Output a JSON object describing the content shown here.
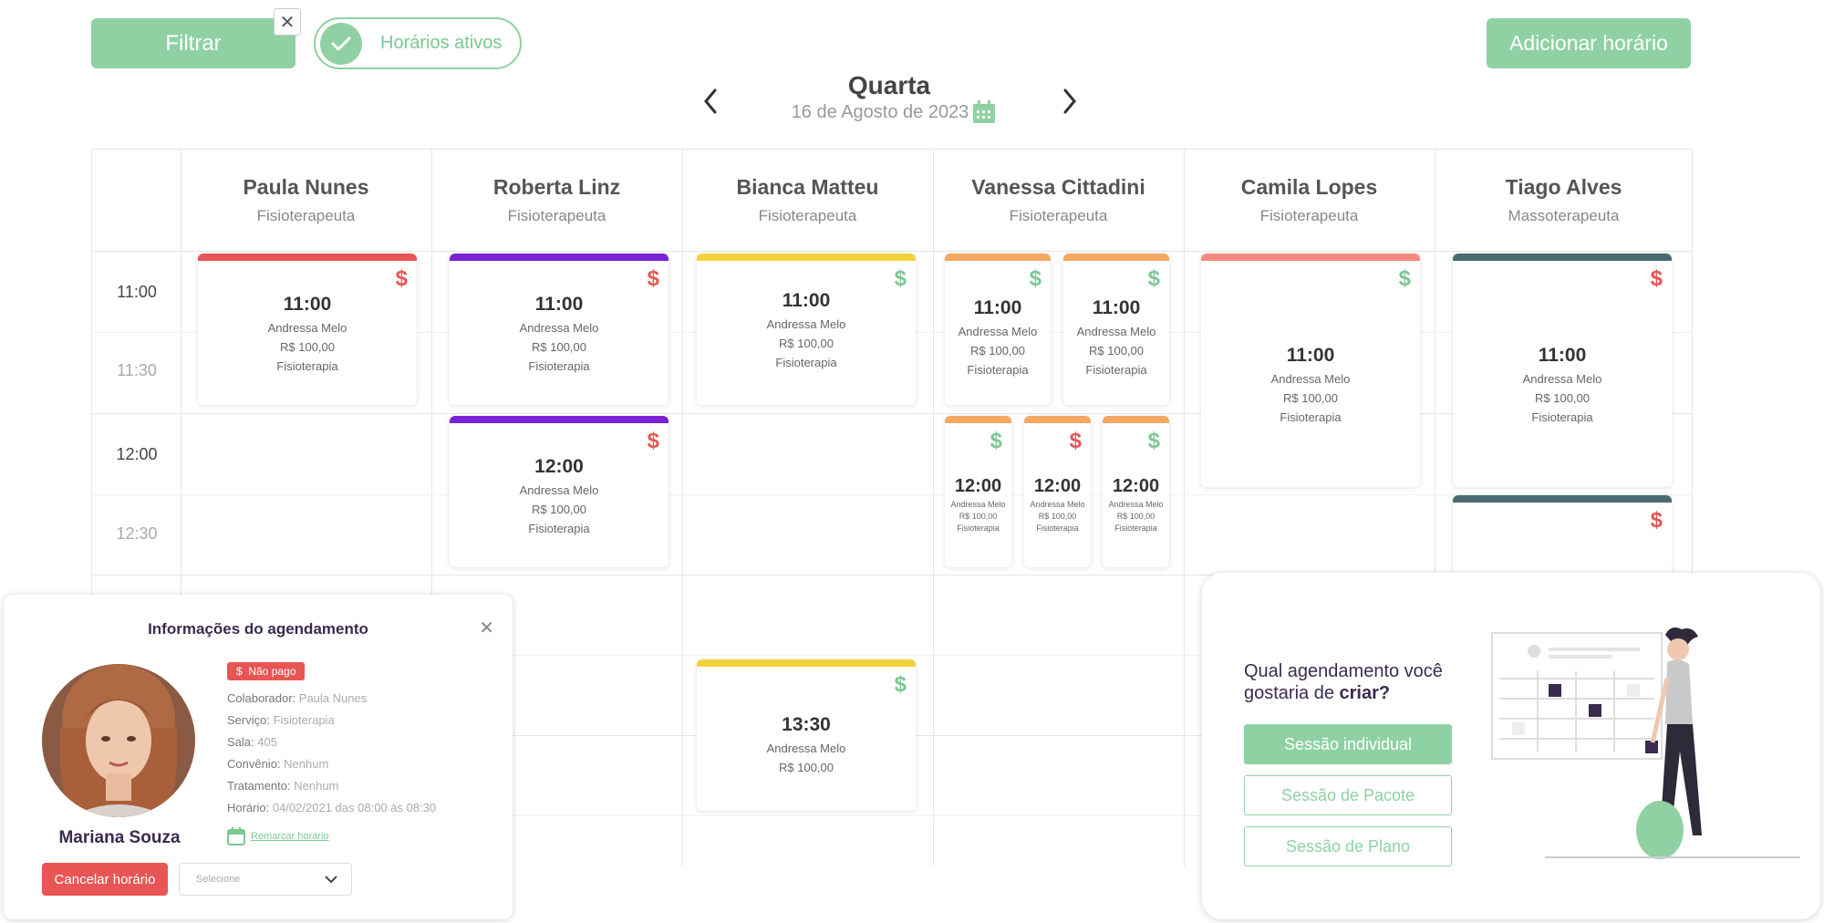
{
  "toolbar": {
    "filter_label": "Filtrar",
    "active_toggle_label": "Horários ativos",
    "add_label": "Adicionar horário"
  },
  "date_nav": {
    "weekday": "Quarta",
    "date": "16 de Agosto de 2023"
  },
  "time_labels": [
    "11:00",
    "11:30",
    "12:00",
    "12:30"
  ],
  "columns": [
    {
      "name": "Paula Nunes",
      "role": "Fisioterapeuta"
    },
    {
      "name": "Roberta Linz",
      "role": "Fisioterapeuta"
    },
    {
      "name": "Bianca Matteu",
      "role": "Fisioterapeuta"
    },
    {
      "name": "Vanessa Cittadini",
      "role": "Fisioterapeuta"
    },
    {
      "name": "Camila Lopes",
      "role": "Fisioterapeuta"
    },
    {
      "name": "Tiago Alves",
      "role": "Massoterapeuta"
    }
  ],
  "appointments": [
    {
      "time": "11:00",
      "patient": "Andressa Melo",
      "price": "R$ 100,00",
      "service": "Fisioterapia",
      "color": "#e85555",
      "paid": false
    },
    {
      "time": "11:00",
      "patient": "Andressa Melo",
      "price": "R$ 100,00",
      "service": "Fisioterapia",
      "color": "#7a22d6",
      "paid": false
    },
    {
      "time": "12:00",
      "patient": "Andressa Melo",
      "price": "R$ 100,00",
      "service": "Fisioterapia",
      "color": "#7a22d6",
      "paid": false
    },
    {
      "time": "11:00",
      "patient": "Andressa Melo",
      "price": "R$ 100,00",
      "service": "Fisioterapia",
      "color": "#f2d23c",
      "paid": true
    },
    {
      "time": "13:30",
      "patient": "Andressa Melo",
      "price": "R$ 100,00",
      "service": "",
      "color": "#f2d23c",
      "paid": true
    },
    {
      "time": "11:00",
      "patient": "Andressa Melo",
      "price": "R$ 100,00",
      "service": "Fisioterapia",
      "color": "#f5a862",
      "paid": true
    },
    {
      "time": "11:00",
      "patient": "Andressa Melo",
      "price": "R$ 100,00",
      "service": "Fisioterapia",
      "color": "#f5a862",
      "paid": true
    },
    {
      "time": "12:00",
      "patient": "Andressa Melo",
      "price": "R$ 100,00",
      "service": "Fisioterapia",
      "color": "#f5a862",
      "paid": true
    },
    {
      "time": "12:00",
      "patient": "Andressa Melo",
      "price": "R$ 100,00",
      "service": "Fisioterapia",
      "color": "#f5a862",
      "paid": false
    },
    {
      "time": "12:00",
      "patient": "Andressa Melo",
      "price": "R$ 100,00",
      "service": "Fisioterapia",
      "color": "#f5a862",
      "paid": true
    },
    {
      "time": "11:00",
      "patient": "Andressa Melo",
      "price": "R$ 100,00",
      "service": "Fisioterapia",
      "color": "#f58a80",
      "paid": true
    },
    {
      "time": "11:00",
      "patient": "Andressa Melo",
      "price": "R$ 100,00",
      "service": "Fisioterapia",
      "color": "#4a6b72",
      "paid": false
    },
    {
      "time": "",
      "patient": "",
      "price": "",
      "service": "",
      "color": "#4a6b72",
      "paid": false
    }
  ],
  "dollar_symbol": "$",
  "info_popup": {
    "title": "Informações do agendamento",
    "patient_name": "Mariana Souza",
    "status_badge": "Não pago",
    "rows": [
      {
        "label": "Colaborador:",
        "value": "Paula Nunes"
      },
      {
        "label": "Serviço:",
        "value": "Fisioterapia"
      },
      {
        "label": "Sala:",
        "value": "405"
      },
      {
        "label": "Convênio:",
        "value": "Nenhum"
      },
      {
        "label": "Tratamento:",
        "value": "Nenhum"
      },
      {
        "label": "Horário:",
        "value": "04/02/2021 das 08:00 às 08:30"
      }
    ],
    "reschedule_label": "Remarcar horário",
    "cancel_label": "Cancelar horário",
    "select_placeholder": "Selecione"
  },
  "create_popup": {
    "question_prefix": "Qual agendamento você gostaria de ",
    "question_bold": "criar?",
    "options": [
      "Sessão individual",
      "Sessão de Pacote",
      "Sessão de Plano"
    ]
  },
  "colors": {
    "accent": "#8fd1a3",
    "paid": "#7cc893",
    "unpaid": "#e85555"
  }
}
